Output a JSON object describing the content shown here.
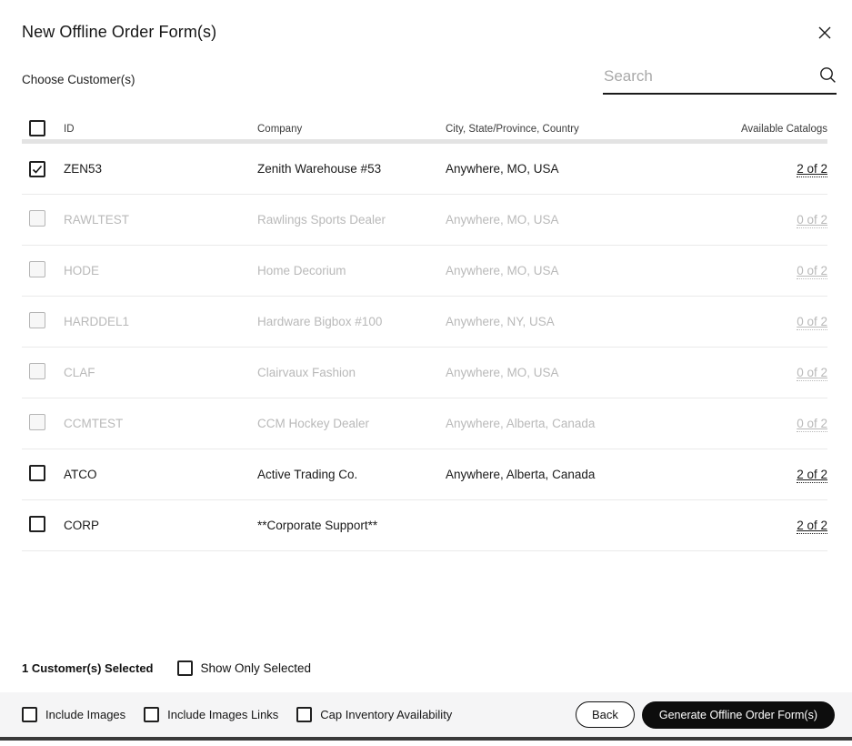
{
  "dialog": {
    "title": "New Offline Order Form(s)"
  },
  "customers": {
    "section_label": "Choose Customer(s)",
    "search": {
      "placeholder": "Search",
      "value": ""
    },
    "table": {
      "headers": {
        "id": "ID",
        "company": "Company",
        "location": "City, State/Province, Country",
        "catalogs": "Available Catalogs"
      },
      "select_all_checked": false,
      "rows": [
        {
          "id": "ZEN53",
          "company": "Zenith Warehouse #53",
          "location": "Anywhere, MO, USA",
          "catalogs": "2 of 2",
          "selected": true,
          "disabled": false
        },
        {
          "id": "RAWLTEST",
          "company": "Rawlings Sports Dealer",
          "location": "Anywhere, MO, USA",
          "catalogs": "0 of 2",
          "selected": false,
          "disabled": true
        },
        {
          "id": "HODE",
          "company": "Home Decorium",
          "location": "Anywhere, MO, USA",
          "catalogs": "0 of 2",
          "selected": false,
          "disabled": true
        },
        {
          "id": "HARDDEL1",
          "company": "Hardware Bigbox #100",
          "location": "Anywhere, NY, USA",
          "catalogs": "0 of 2",
          "selected": false,
          "disabled": true
        },
        {
          "id": "CLAF",
          "company": "Clairvaux Fashion",
          "location": "Anywhere, MO, USA",
          "catalogs": "0 of 2",
          "selected": false,
          "disabled": true
        },
        {
          "id": "CCMTEST",
          "company": "CCM Hockey Dealer",
          "location": "Anywhere, Alberta, Canada",
          "catalogs": "0 of 2",
          "selected": false,
          "disabled": true
        },
        {
          "id": "ATCO",
          "company": "Active Trading Co.",
          "location": "Anywhere, Alberta, Canada",
          "catalogs": "2 of 2",
          "selected": false,
          "disabled": false
        },
        {
          "id": "CORP",
          "company": "**Corporate Support**",
          "location": "",
          "catalogs": "2 of 2",
          "selected": false,
          "disabled": false
        }
      ]
    },
    "summary": {
      "selected_text": "1 Customer(s) Selected",
      "show_only_label": "Show Only Selected",
      "show_only_checked": false
    }
  },
  "action_bar": {
    "options": [
      {
        "label": "Include Images",
        "checked": false
      },
      {
        "label": "Include Images Links",
        "checked": false
      },
      {
        "label": "Cap Inventory Availability",
        "checked": false
      }
    ],
    "back_label": "Back",
    "generate_label": "Generate Offline Order Form(s)"
  },
  "colors": {
    "accent": "#111111",
    "disabled_text": "#b9b9b9",
    "action_bar_bg": "#f5f5f6",
    "divider": "#eaeaea"
  }
}
